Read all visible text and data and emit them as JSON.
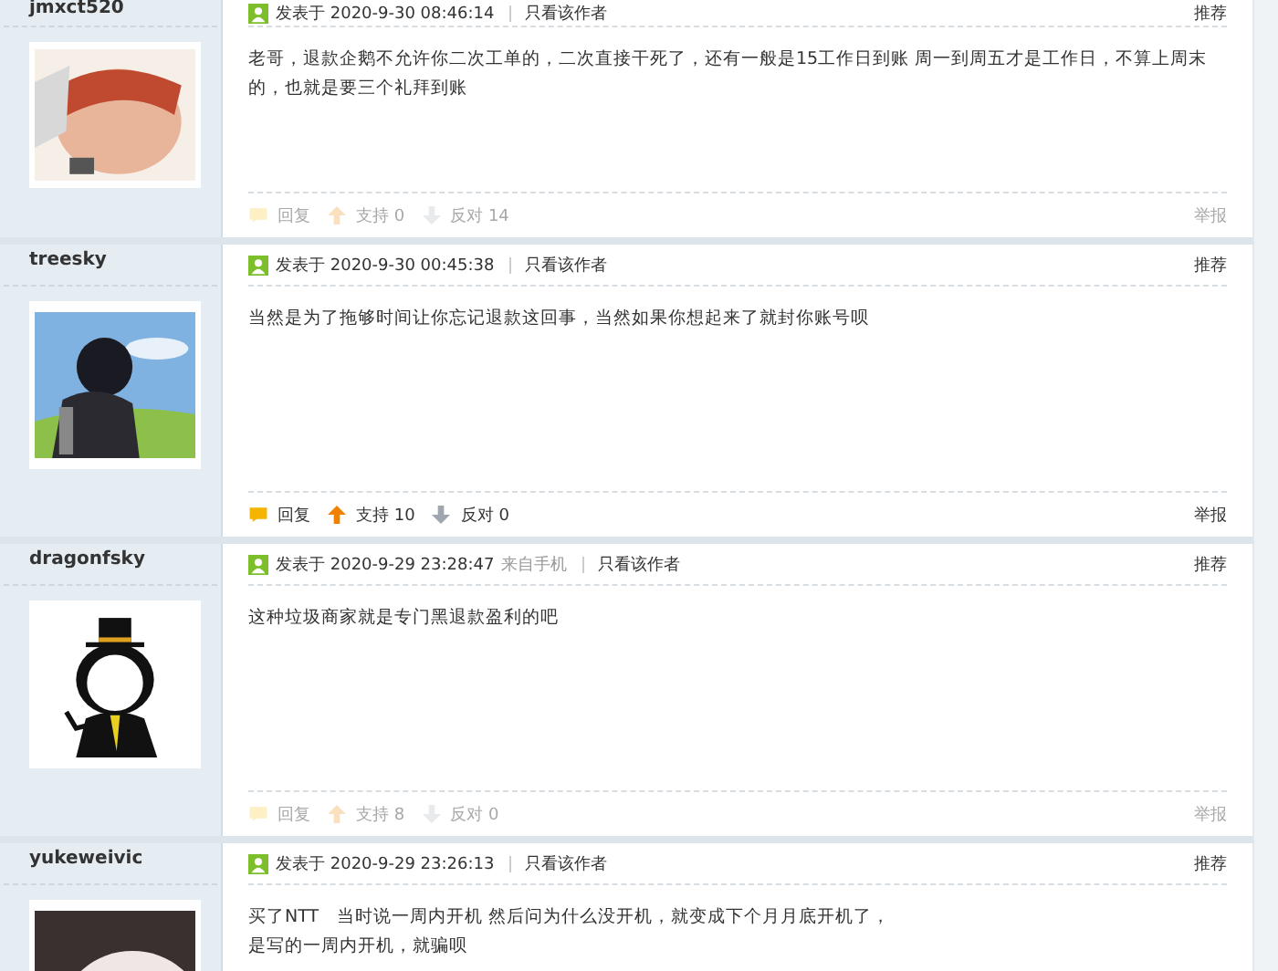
{
  "posts": [
    {
      "username": "jmxct520",
      "avatar": {
        "kind": "picture"
      },
      "posted": "发表于 2020-9-30 08:46:14",
      "author_only": "只看该作者",
      "recommend": "推荐",
      "body": [
        "老哥，退款企鹅不允许你二次工单的，二次直接干死了，还有一般是15工作日到账 周一到周五才是工作日，不算上周末的，也就是要三个礼拜到账"
      ],
      "faded": true,
      "reply": "回复",
      "support": "支持 0",
      "oppose": "反对 14",
      "report": "举报"
    },
    {
      "username": "treesky",
      "avatar": {
        "kind": "picture"
      },
      "posted": "发表于 2020-9-30 00:45:38",
      "author_only": "只看该作者",
      "recommend": "推荐",
      "body": [
        "当然是为了拖够时间让你忘记退款这回事，当然如果你想起来了就封你账号呗"
      ],
      "faded": false,
      "reply": "回复",
      "support": "支持 10",
      "oppose": "反对 0",
      "report": "举报"
    },
    {
      "username": "dragonfsky",
      "avatar": {
        "kind": "cartoon"
      },
      "posted": "发表于 2020-9-29 23:28:47",
      "source": "来自手机",
      "author_only": "只看该作者",
      "recommend": "推荐",
      "body": [
        "这种垃圾商家就是专门黑退款盈利的吧"
      ],
      "faded": true,
      "reply": "回复",
      "support": "支持 8",
      "oppose": "反对 0",
      "report": "举报"
    },
    {
      "username": "yukeweivic",
      "avatar": {
        "kind": "picture"
      },
      "posted": "发表于 2020-9-29 23:26:13",
      "author_only": "只看该作者",
      "recommend": "推荐",
      "body": [
        "买了NTT　当时说一周内开机  然后问为什么没开机，就变成下个月月底开机了，",
        "是写的一周内开机，就骗呗"
      ]
    }
  ]
}
